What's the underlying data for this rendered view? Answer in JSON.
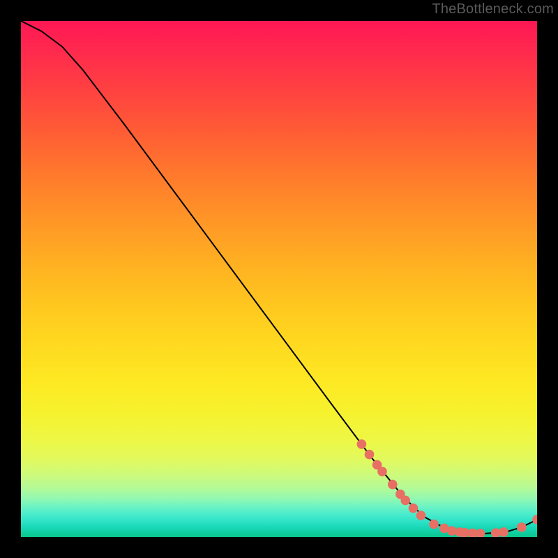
{
  "watermark": "TheBottleneck.com",
  "chart_data": {
    "type": "line",
    "title": "",
    "xlabel": "",
    "ylabel": "",
    "xlim": [
      0,
      100
    ],
    "ylim": [
      0,
      100
    ],
    "grid": false,
    "curve": [
      {
        "x": 0,
        "y": 100
      },
      {
        "x": 4,
        "y": 98
      },
      {
        "x": 8,
        "y": 95
      },
      {
        "x": 12,
        "y": 90.5
      },
      {
        "x": 20,
        "y": 80
      },
      {
        "x": 30,
        "y": 66.5
      },
      {
        "x": 40,
        "y": 53
      },
      {
        "x": 50,
        "y": 39.5
      },
      {
        "x": 60,
        "y": 26
      },
      {
        "x": 68,
        "y": 15.3
      },
      {
        "x": 74,
        "y": 7.9
      },
      {
        "x": 78,
        "y": 4.0
      },
      {
        "x": 82,
        "y": 1.8
      },
      {
        "x": 86,
        "y": 0.9
      },
      {
        "x": 90,
        "y": 0.7
      },
      {
        "x": 94,
        "y": 1.0
      },
      {
        "x": 97,
        "y": 1.9
      },
      {
        "x": 100,
        "y": 3.4
      }
    ],
    "markers": [
      {
        "x": 66.0,
        "y": 18.0
      },
      {
        "x": 67.5,
        "y": 16.0
      },
      {
        "x": 69.0,
        "y": 14.0
      },
      {
        "x": 70.0,
        "y": 12.7
      },
      {
        "x": 72.0,
        "y": 10.2
      },
      {
        "x": 73.5,
        "y": 8.3
      },
      {
        "x": 74.5,
        "y": 7.1
      },
      {
        "x": 76.0,
        "y": 5.6
      },
      {
        "x": 77.5,
        "y": 4.2
      },
      {
        "x": 80.0,
        "y": 2.5
      },
      {
        "x": 82.0,
        "y": 1.7
      },
      {
        "x": 83.5,
        "y": 1.2
      },
      {
        "x": 85.0,
        "y": 0.95
      },
      {
        "x": 86.0,
        "y": 0.85
      },
      {
        "x": 87.5,
        "y": 0.75
      },
      {
        "x": 89.0,
        "y": 0.7
      },
      {
        "x": 92.0,
        "y": 0.8
      },
      {
        "x": 93.5,
        "y": 0.95
      },
      {
        "x": 97.0,
        "y": 1.9
      },
      {
        "x": 100.0,
        "y": 3.4
      }
    ],
    "marker_color": "#e76f63",
    "curve_color": "#000000"
  }
}
